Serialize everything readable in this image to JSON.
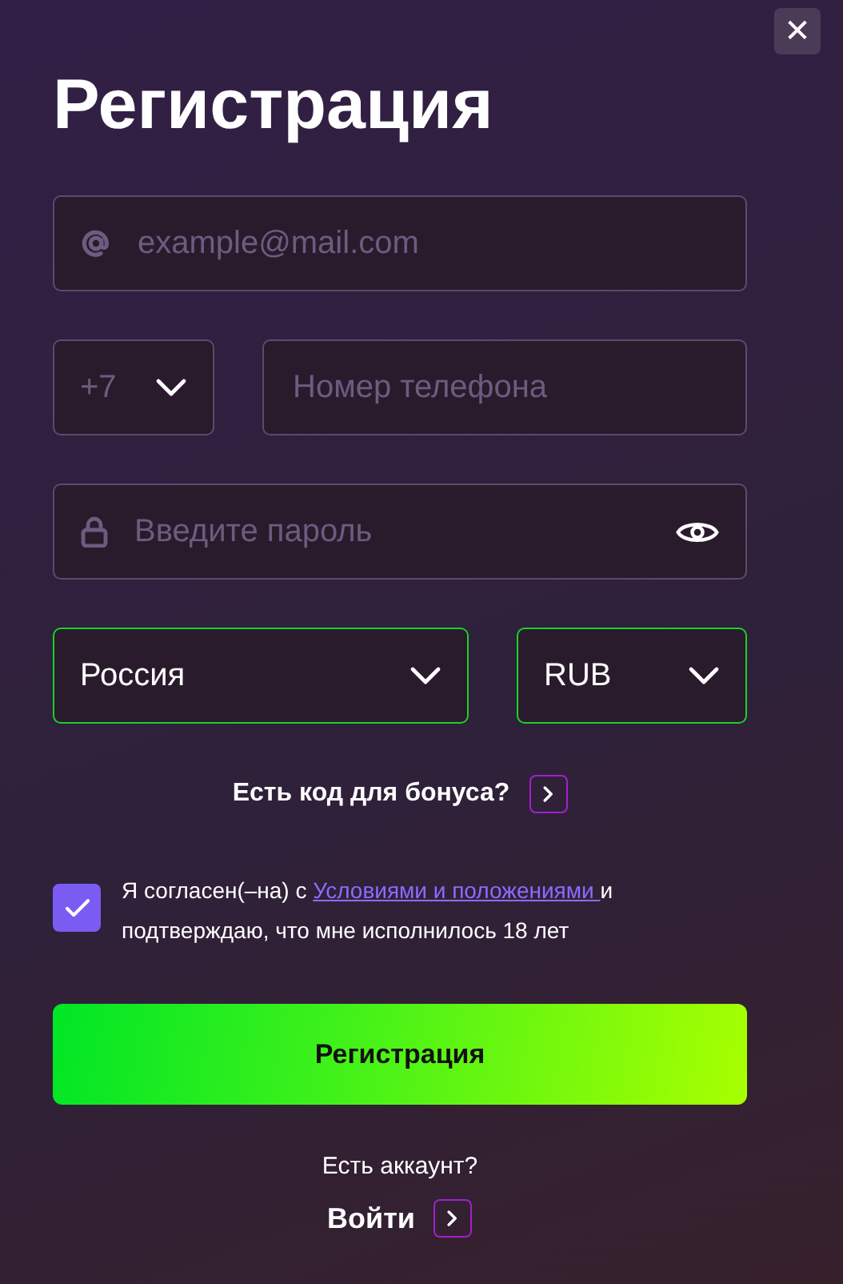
{
  "close_button": "✕",
  "title": "Регистрация",
  "email": {
    "placeholder": "example@mail.com"
  },
  "phone": {
    "code": "+7",
    "placeholder": "Номер телефона"
  },
  "password": {
    "placeholder": "Введите пароль"
  },
  "country": {
    "value": "Россия"
  },
  "currency": {
    "value": "RUB"
  },
  "bonus_link": "Есть код для бонуса?",
  "agreement": {
    "checked": true,
    "text_before": "Я согласен(–на) с ",
    "link": "Условиями и положениями ",
    "text_after": "и подтверждаю, что мне исполнилось 18 лет"
  },
  "submit_button": "Регистрация",
  "login_prompt": "Есть аккаунт?",
  "login_link": "Войти"
}
